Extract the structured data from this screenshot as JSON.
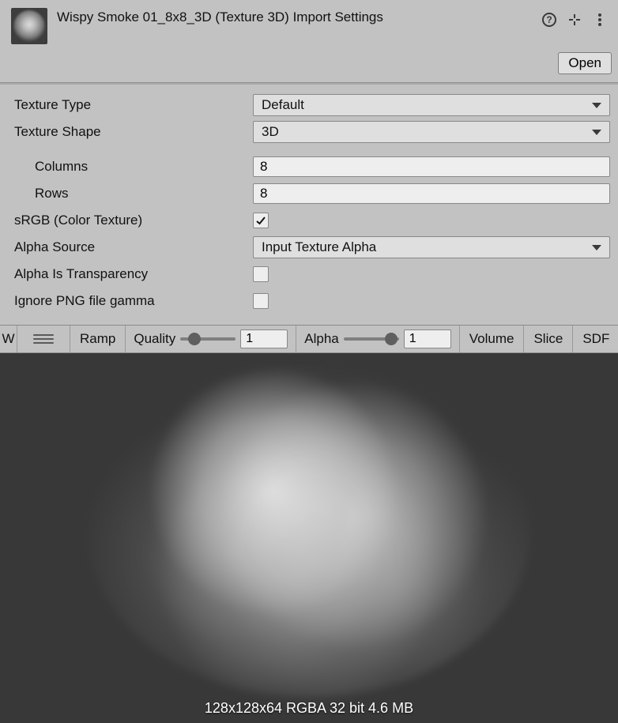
{
  "header": {
    "title": "Wispy Smoke 01_8x8_3D (Texture 3D) Import Settings",
    "open_button": "Open",
    "help_icon": "help-icon",
    "preset_icon": "preset-icon",
    "menu_icon": "kebab-icon"
  },
  "form": {
    "texture_type": {
      "label": "Texture Type",
      "value": "Default"
    },
    "texture_shape": {
      "label": "Texture Shape",
      "value": "3D"
    },
    "columns": {
      "label": "Columns",
      "value": "8"
    },
    "rows": {
      "label": "Rows",
      "value": "8"
    },
    "srgb": {
      "label": "sRGB (Color Texture)",
      "checked": true
    },
    "alpha_source": {
      "label": "Alpha Source",
      "value": "Input Texture Alpha"
    },
    "alpha_transparency": {
      "label": "Alpha Is Transparency",
      "checked": false
    },
    "ignore_png_gamma": {
      "label": "Ignore PNG file gamma",
      "checked": false
    }
  },
  "toolbar": {
    "w": "W",
    "ramp": "Ramp",
    "quality": {
      "label": "Quality",
      "value": "1"
    },
    "alpha": {
      "label": "Alpha",
      "value": "1"
    },
    "volume": "Volume",
    "slice": "Slice",
    "sdf": "SDF"
  },
  "preview": {
    "info": "128x128x64 RGBA 32 bit 4.6 MB"
  }
}
